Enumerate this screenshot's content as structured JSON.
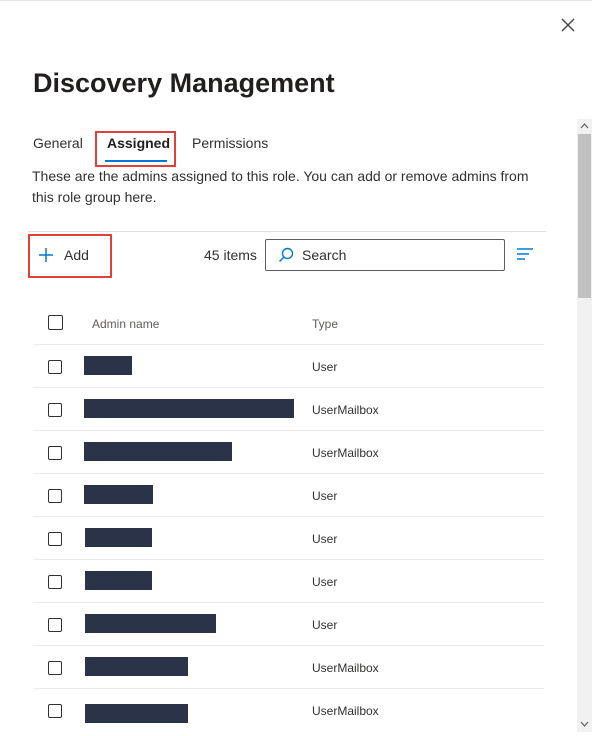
{
  "panel": {
    "title": "Discovery Management",
    "close_icon": "close-icon"
  },
  "tabs": [
    {
      "label": "General"
    },
    {
      "label": "Assigned",
      "selected": true
    },
    {
      "label": "Permissions"
    }
  ],
  "description": "These are the admins assigned to this role. You can add or remove admins from this role group here.",
  "toolbar": {
    "add_label": "Add",
    "add_icon": "plus-icon",
    "item_count": "45 items",
    "search_placeholder": "Search",
    "search_icon": "search-icon",
    "filter_icon": "filter-lines-icon"
  },
  "table": {
    "columns": [
      "Admin name",
      "Type"
    ],
    "rows": [
      {
        "name": "[redacted]",
        "type": "User"
      },
      {
        "name": "[redacted]",
        "type": "UserMailbox"
      },
      {
        "name": "[redacted]",
        "type": "UserMailbox"
      },
      {
        "name": "[redacted]",
        "type": "User"
      },
      {
        "name": "[redacted]",
        "type": "User"
      },
      {
        "name": "[redacted]",
        "type": "User"
      },
      {
        "name": "[redacted]",
        "type": "User"
      },
      {
        "name": "[redacted]",
        "type": "UserMailbox"
      },
      {
        "name": "[redacted]",
        "type": "UserMailbox"
      }
    ]
  },
  "colors": {
    "accent": "#0078d4",
    "highlight_box": "#e0403a",
    "redaction": "#2a3347"
  }
}
